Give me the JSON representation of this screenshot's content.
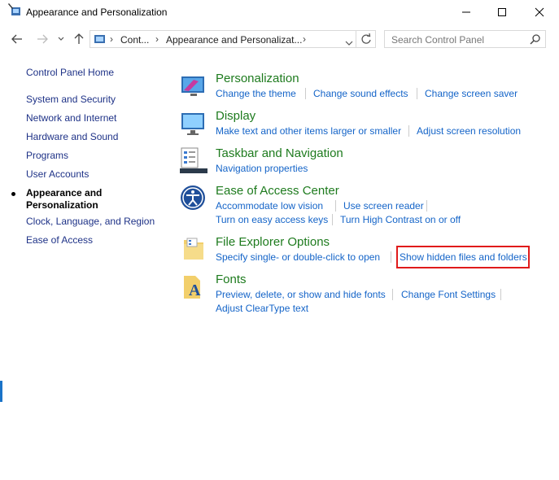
{
  "window": {
    "title": "Appearance and Personalization",
    "minimize_label": "–",
    "maximize_label": "☐",
    "close_label": "✕"
  },
  "address": {
    "breadcrumb": [
      "Cont...",
      "Appearance and Personalizat..."
    ],
    "search_placeholder": "Search Control Panel"
  },
  "sidebar": {
    "home": "Control Panel Home",
    "items": [
      "System and Security",
      "Network and Internet",
      "Hardware and Sound",
      "Programs",
      "User Accounts",
      "Appearance and Personalization",
      "Clock, Language, and Region",
      "Ease of Access"
    ],
    "current_line1": "Appearance and",
    "current_line2": "Personalization"
  },
  "categories": [
    {
      "title": "Personalization",
      "icon": "personalization-icon",
      "tasks": [
        "Change the theme",
        "Change sound effects",
        "Change screen saver"
      ]
    },
    {
      "title": "Display",
      "icon": "display-icon",
      "tasks": [
        "Make text and other items larger or smaller",
        "Adjust screen resolution"
      ]
    },
    {
      "title": "Taskbar and Navigation",
      "icon": "taskbar-icon",
      "tasks": [
        "Navigation properties"
      ]
    },
    {
      "title": "Ease of Access Center",
      "icon": "ease-of-access-icon",
      "tasks": [
        "Accommodate low vision",
        "Use screen reader",
        "Turn on easy access keys",
        "Turn High Contrast on or off"
      ]
    },
    {
      "title": "File Explorer Options",
      "icon": "folder-options-icon",
      "tasks": [
        "Specify single- or double-click to open",
        "Show hidden files and folders"
      ]
    },
    {
      "title": "Fonts",
      "icon": "fonts-icon",
      "tasks": [
        "Preview, delete, or show and hide fonts",
        "Change Font Settings",
        "Adjust ClearType text"
      ]
    }
  ],
  "colors": {
    "category_title": "#1e7b1e",
    "task_link": "#1464c8",
    "highlight_border": "#e01b1b"
  }
}
